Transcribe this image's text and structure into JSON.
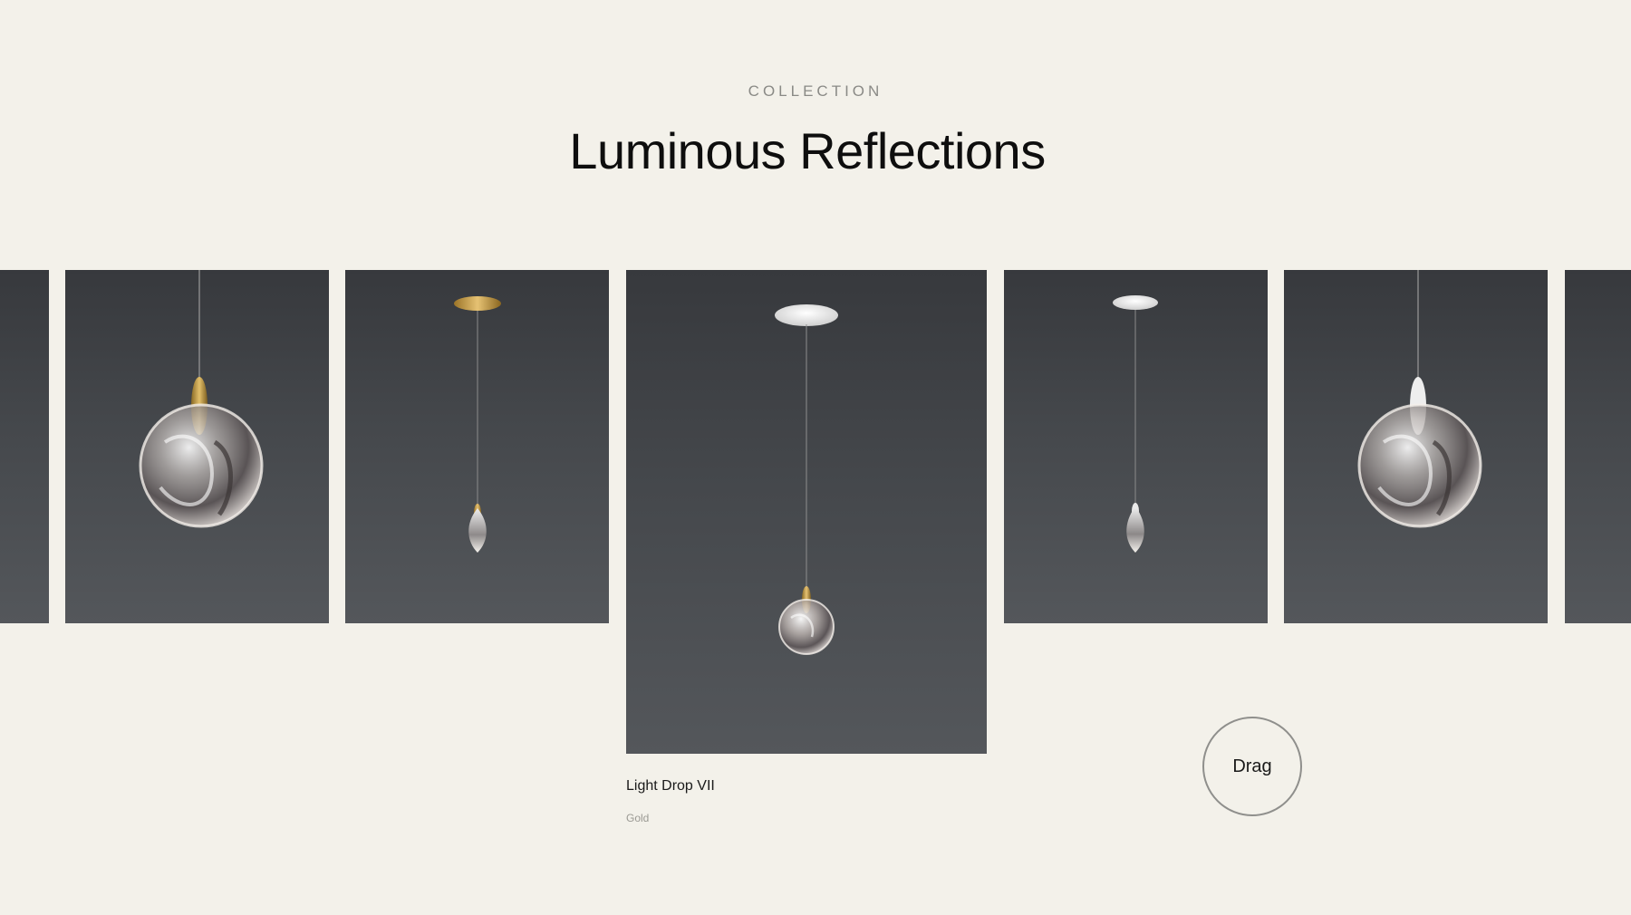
{
  "section": {
    "eyebrow": "COLLECTION",
    "title": "Luminous Reflections"
  },
  "carousel": {
    "active_item": {
      "name": "Light Drop VII",
      "finish": "Gold"
    },
    "drag_label": "Drag"
  },
  "colors": {
    "background": "#f3f1ea",
    "card_top": "#37393d",
    "card_bottom": "#54575b",
    "gold": "#c9a24a",
    "white_canopy": "#e6e6e6"
  }
}
